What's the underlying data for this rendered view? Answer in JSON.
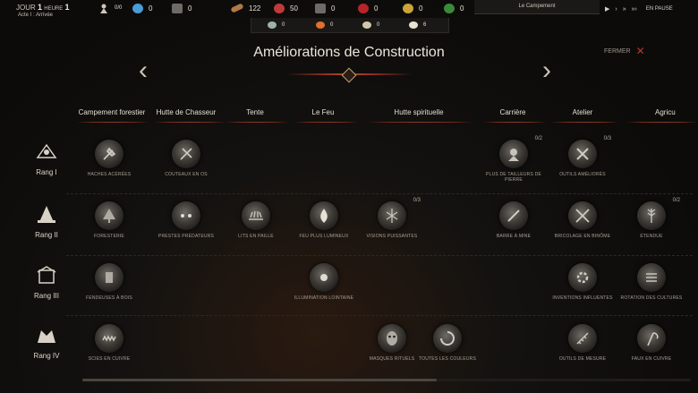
{
  "status": {
    "day_label": "JOUR",
    "day": "1",
    "hour_label": "HEURE",
    "hour": "1",
    "act": "Acte I : Arrivée"
  },
  "top_resources": [
    {
      "icon": "villager-icon",
      "value": "0/0",
      "color": "#cfc7b8"
    },
    {
      "icon": "spirit-orb-icon",
      "value": "0",
      "color": "#4a9bd6"
    },
    {
      "icon": "ore-icon",
      "value": "0",
      "color": "#8a8580"
    },
    {
      "icon": "wood-log-icon",
      "value": "122",
      "color": "#b07a45"
    },
    {
      "icon": "meat-icon",
      "value": "50",
      "color": "#c0393b"
    },
    {
      "icon": "stone-icon",
      "value": "0",
      "color": "#6e6a66"
    },
    {
      "icon": "berry-icon",
      "value": "0",
      "color": "#b4252a"
    },
    {
      "icon": "gold-skull-icon",
      "value": "0",
      "color": "#c9a53a"
    },
    {
      "icon": "herb-icon",
      "value": "0",
      "color": "#3a8a3a"
    }
  ],
  "sub_resources": [
    {
      "icon": "fish-icon",
      "value": "0",
      "color": "#9fb3a8"
    },
    {
      "icon": "fire-icon",
      "value": "0",
      "color": "#e0702a"
    },
    {
      "icon": "torch-icon",
      "value": "0",
      "color": "#d0c7a8"
    },
    {
      "icon": "bone-icon",
      "value": "6",
      "color": "#e8e2d0"
    }
  ],
  "location": "Le Campement",
  "speed": {
    "pause_label": "EN PAUSE"
  },
  "title": "Améliorations de Construction",
  "close_label": "FERMER",
  "categories": [
    "Campement forestier",
    "Hutte de Chasseur",
    "Tente",
    "Le Feu",
    "Hutte spirituelle",
    "Carrière",
    "Atelier",
    "Agricu"
  ],
  "ranks": [
    "Rang I",
    "Rang II",
    "Rang III",
    "Rang IV"
  ],
  "upgrades": {
    "r1_axes": "HACHES ACÉRÉES",
    "r1_knives": "COUTEAUX EN OS",
    "r1_quarry": "PLUS DE TAILLEURS DE PIERRE",
    "r1_quarry_count": "0/2",
    "r1_workshop": "OUTILS AMÉLIORÉS",
    "r1_workshop_count": "0/3",
    "r2_forestry": "FORESTERIE",
    "r2_predators": "PRESTES PRÉDATEURS",
    "r2_straw": "LITS EN PAILLE",
    "r2_fire": "FEU PLUS LUMINEUX",
    "r2_visions": "VISIONS PUISSANTES",
    "r2_visions_count": "0/3",
    "r2_barrow": "BARRE À MINE",
    "r2_tinker": "BRICOLAGE EN BINÔME",
    "r2_expanse": "ÉTENDUE",
    "r2_expanse_count": "0/2",
    "r3_splitters": "FENDEUSES À BOIS",
    "r3_illumination": "ILLUMINATION LOINTAINE",
    "r3_inventions": "INVENTIONS INFLUENTES",
    "r3_rotation": "ROTATION DES CULTURES",
    "r4_saws": "SCIES EN CUIVRE",
    "r4_masks": "MASQUES RITUELS",
    "r4_colors": "TOUTES LES COULEURS",
    "r4_tools": "OUTILS DE MESURE",
    "r4_scythe": "FAUX EN CUIVRE"
  }
}
